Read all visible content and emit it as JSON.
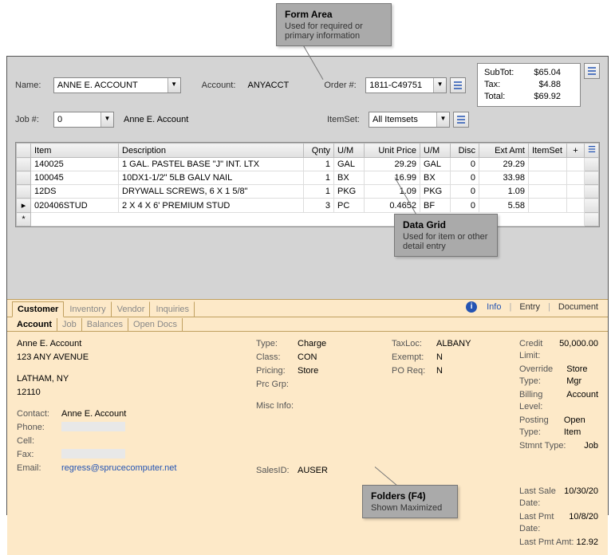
{
  "callouts": {
    "form": {
      "title": "Form Area",
      "desc": "Used for required or primary information"
    },
    "grid": {
      "title": "Data Grid",
      "desc": "Used for item or other detail entry"
    },
    "folders": {
      "title": "Folders (F4)",
      "desc": "Shown Maximized"
    }
  },
  "form": {
    "name_label": "Name:",
    "name_value": "ANNE E. ACCOUNT",
    "account_label": "Account:",
    "account_value": "ANYACCT",
    "order_label": "Order #:",
    "order_value": "1811-C49751",
    "job_label": "Job #:",
    "job_value": "0",
    "job_name": "Anne E. Account",
    "itemset_label": "ItemSet:",
    "itemset_value": "All Itemsets"
  },
  "totals": {
    "subtot_label": "SubTot:",
    "subtot_value": "$65.04",
    "tax_label": "Tax:",
    "tax_value": "$4.88",
    "total_label": "Total:",
    "total_value": "$69.92"
  },
  "grid": {
    "headers": {
      "item": "Item",
      "desc": "Description",
      "qty": "Qnty",
      "um1": "U/M",
      "price": "Unit Price",
      "um2": "U/M",
      "disc": "Disc",
      "ext": "Ext Amt",
      "itemset": "ItemSet",
      "plus": "+"
    },
    "rows": [
      {
        "item": "140025",
        "desc": "1 GAL. PASTEL BASE \"J\" INT. LTX",
        "qty": "1",
        "um1": "GAL",
        "price": "29.29",
        "um2": "GAL",
        "disc": "0",
        "ext": "29.29"
      },
      {
        "item": "100045",
        "desc": "10DX1-1/2\" 5LB GALV NAIL",
        "qty": "1",
        "um1": "BX",
        "price": "16.99",
        "um2": "BX",
        "disc": "0",
        "ext": "33.98"
      },
      {
        "item": "12DS",
        "desc": "DRYWALL SCREWS, 6 X 1 5/8\"",
        "qty": "1",
        "um1": "PKG",
        "price": "1.09",
        "um2": "PKG",
        "disc": "0",
        "ext": "1.09"
      },
      {
        "item": "020406STUD",
        "desc": "2 X 4 X 6' PREMIUM STUD",
        "qty": "3",
        "um1": "PC",
        "price": "0.4652",
        "um2": "BF",
        "disc": "0",
        "ext": "5.58"
      }
    ],
    "row_markers": {
      "current": "▸",
      "new": "*"
    }
  },
  "tabs": {
    "primary": [
      "Customer",
      "Inventory",
      "Vendor",
      "Inquiries"
    ],
    "right": {
      "info": "Info",
      "entry": "Entry",
      "document": "Document"
    },
    "secondary": [
      "Account",
      "Job",
      "Balances",
      "Open Docs"
    ]
  },
  "account": {
    "name": "Anne E. Account",
    "addr1": "123 ANY AVENUE",
    "city": "LATHAM, NY",
    "zip": "12110",
    "contact_label": "Contact:",
    "contact": "Anne E. Account",
    "phone_label": "Phone:",
    "cell_label": "Cell:",
    "fax_label": "Fax:",
    "email_label": "Email:",
    "email": "regress@sprucecomputer.net",
    "type_label": "Type:",
    "type": "Charge",
    "class_label": "Class:",
    "class": "CON",
    "pricing_label": "Pricing:",
    "pricing": "Store",
    "prcgrp_label": "Prc Grp:",
    "misc_label": "Misc Info:",
    "salesid_label": "SalesID:",
    "salesid": "AUSER",
    "taxloc_label": "TaxLoc:",
    "taxloc": "ALBANY",
    "exempt_label": "Exempt:",
    "exempt": "N",
    "poreq_label": "PO Req:",
    "poreq": "N",
    "credit_label": "Credit Limit:",
    "credit": "50,000.00",
    "override_label": "Override Type:",
    "override": "Store Mgr",
    "billing_label": "Billing Level:",
    "billing": "Account",
    "posting_label": "Posting Type:",
    "posting": "Open Item",
    "stmnt_label": "Stmnt Type:",
    "stmnt": "Job",
    "lastsale_label": "Last Sale Date:",
    "lastsale": "10/30/20",
    "lastpmt_label": "Last Pmt Date:",
    "lastpmt": "10/8/20",
    "lastamt_label": "Last Pmt Amt:",
    "lastamt": "12.92"
  }
}
